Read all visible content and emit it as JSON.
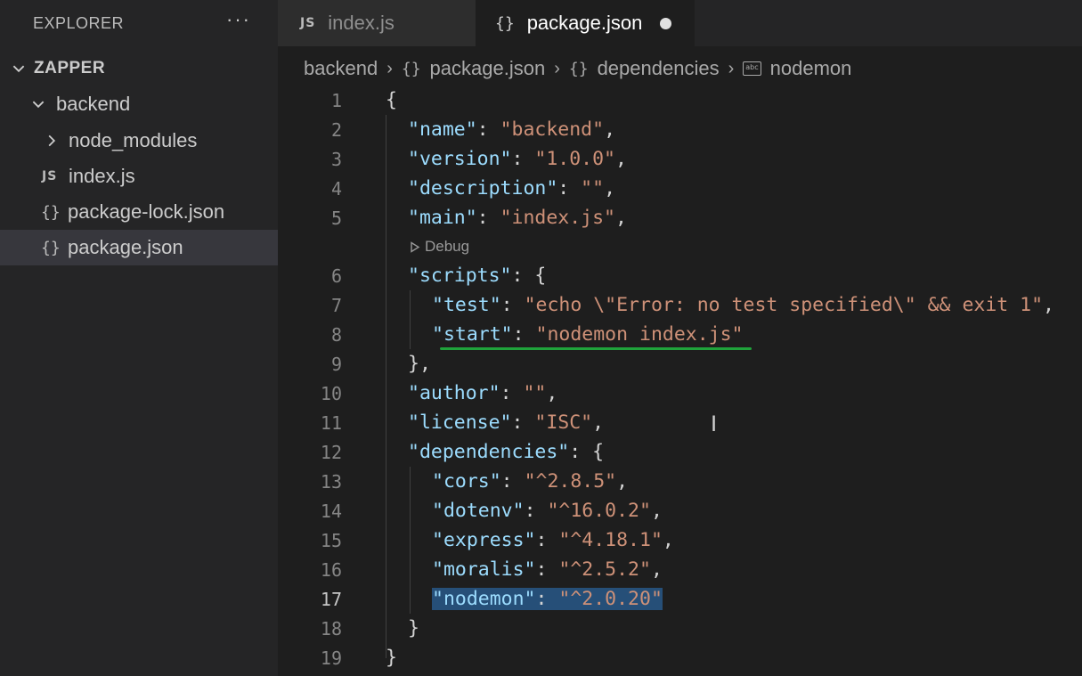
{
  "explorer": {
    "title": "EXPLORER",
    "more": "···",
    "tree": [
      {
        "label": "ZAPPER",
        "kind": "root"
      },
      {
        "label": "backend",
        "kind": "folder-open"
      },
      {
        "label": "node_modules",
        "kind": "folder-closed"
      },
      {
        "label": "index.js",
        "kind": "js",
        "icon_text": "JS"
      },
      {
        "label": "package-lock.json",
        "kind": "json",
        "icon_text": "{}"
      },
      {
        "label": "package.json",
        "kind": "json",
        "icon_text": "{}",
        "selected": true
      }
    ]
  },
  "tabs": [
    {
      "label": "index.js",
      "icon_text": "JS",
      "active": false
    },
    {
      "label": "package.json",
      "icon_text": "{}",
      "active": true,
      "dirty": true
    }
  ],
  "breadcrumb": {
    "items": [
      "backend",
      "package.json",
      "dependencies",
      "nodemon"
    ],
    "brace_icon": "{}",
    "string_icon": "abc"
  },
  "codelens": {
    "label": "Debug",
    "icon": "play-outline-icon"
  },
  "editor": {
    "current_line": 17,
    "lines": [
      {
        "n": "1",
        "text": "{"
      },
      {
        "n": "2",
        "key": "\"name\"",
        "value": "\"backend\"",
        "trail": ","
      },
      {
        "n": "3",
        "key": "\"version\"",
        "value": "\"1.0.0\"",
        "trail": ","
      },
      {
        "n": "4",
        "key": "\"description\"",
        "value": "\"\"",
        "trail": ","
      },
      {
        "n": "5",
        "key": "\"main\"",
        "value": "\"index.js\"",
        "trail": ","
      },
      {
        "n": "6",
        "key": "\"scripts\"",
        "value": "",
        "trail": "{"
      },
      {
        "n": "7",
        "key": "\"test\"",
        "value": "\"echo \\\"Error: no test specified\\\" && exit 1\"",
        "trail": ","
      },
      {
        "n": "8",
        "key": "\"start\"",
        "value": "\"nodemon index.js\"",
        "trail": ""
      },
      {
        "n": "9",
        "text": "},"
      },
      {
        "n": "10",
        "key": "\"author\"",
        "value": "\"\"",
        "trail": ","
      },
      {
        "n": "11",
        "key": "\"license\"",
        "value": "\"ISC\"",
        "trail": ","
      },
      {
        "n": "12",
        "key": "\"dependencies\"",
        "value": "",
        "trail": "{"
      },
      {
        "n": "13",
        "key": "\"cors\"",
        "value": "\"^2.8.5\"",
        "trail": ","
      },
      {
        "n": "14",
        "key": "\"dotenv\"",
        "value": "\"^16.0.2\"",
        "trail": ","
      },
      {
        "n": "15",
        "key": "\"express\"",
        "value": "\"^4.18.1\"",
        "trail": ","
      },
      {
        "n": "16",
        "key": "\"moralis\"",
        "value": "\"^2.5.2\"",
        "trail": ","
      },
      {
        "n": "17",
        "key": "\"nodemon\"",
        "value": "\"^2.0.20\"",
        "trail": ""
      },
      {
        "n": "18",
        "text": "}"
      },
      {
        "n": "19",
        "text": "}"
      }
    ]
  },
  "colors": {
    "key": "#9cdcfe",
    "string": "#ce9178",
    "selection": "#264f78",
    "annotation_underline": "#1fa33b"
  }
}
